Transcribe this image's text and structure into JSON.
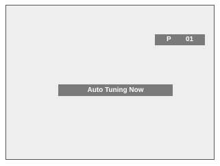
{
  "channel": {
    "prefix": "P",
    "number": "01"
  },
  "status": {
    "message": "Auto Tuning Now"
  },
  "colors": {
    "screen_background": "#eeeeee",
    "osd_background": "#7a7a7a",
    "osd_text": "#ffffff",
    "frame_border": "#555555"
  }
}
